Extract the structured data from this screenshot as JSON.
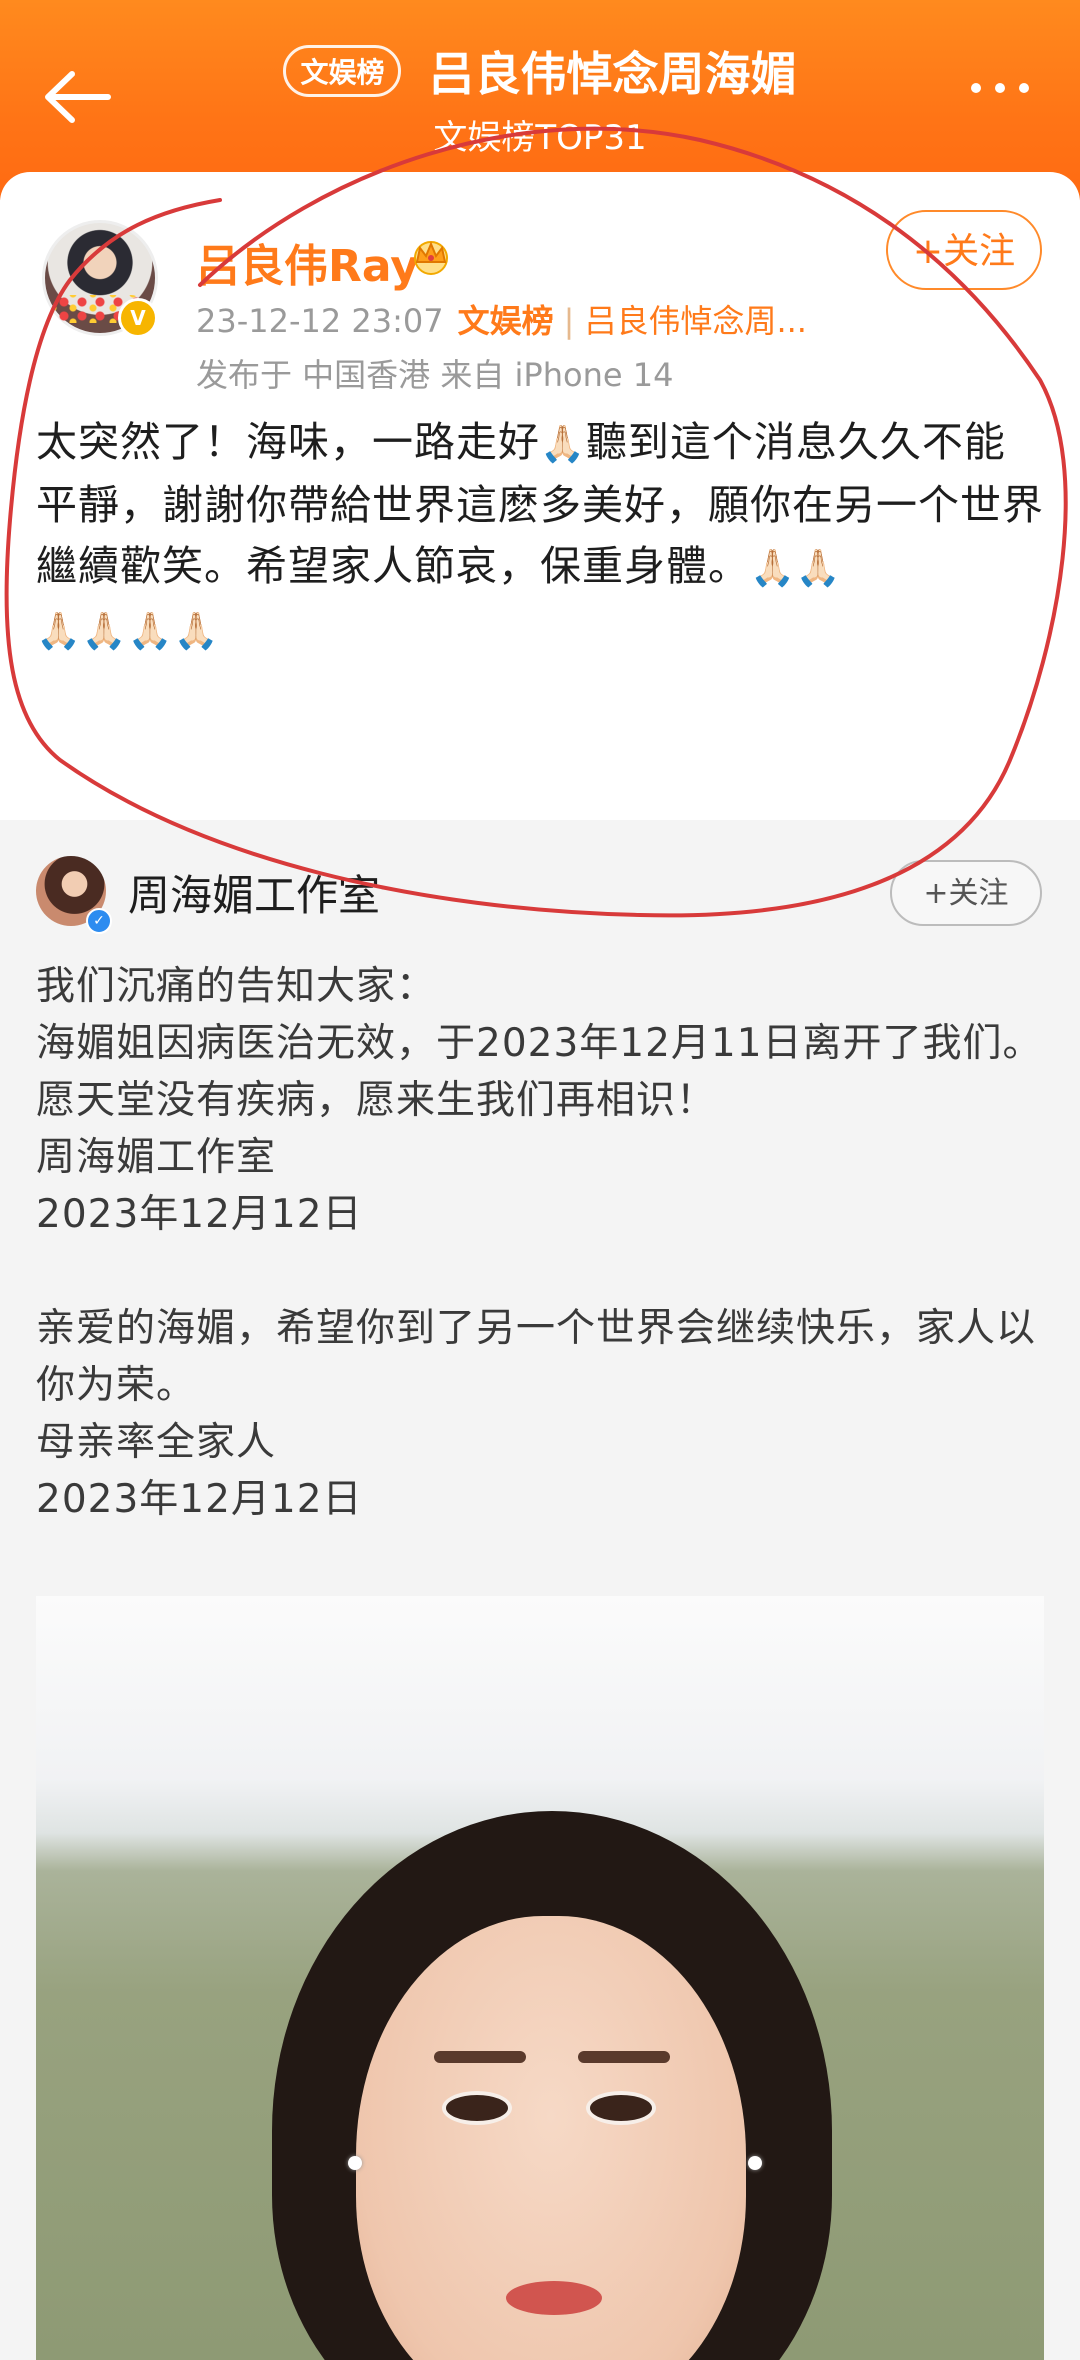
{
  "header": {
    "badge": "文娱榜",
    "title": "吕良伟悼念周海媚",
    "subtitle": "文娱榜TOP31"
  },
  "post": {
    "author": "吕良伟Ray",
    "datetime": "23-12-12 23:07",
    "tag": "文娱榜",
    "topic": "吕良伟悼念周...",
    "source": "发布于 中国香港  来自 iPhone 14",
    "follow_label": "+关注",
    "body_1": "太突然了！海味，一路走好",
    "body_2": "聽到這个消息久久不能平靜，謝謝你帶給世界這麽多美好，願你在另一个世界繼續歡笑。希望家人節哀，保重身體。",
    "pray_emoji_1": "🙏🏻",
    "pray_emoji_2": "🙏🏻🙏🏻",
    "pray_emoji_3": "🙏🏻🙏🏻🙏🏻🙏🏻"
  },
  "repost": {
    "author": "周海媚工作室",
    "follow_label": "+关注",
    "lines": [
      "我们沉痛的告知大家：",
      "海媚姐因病医治无效，于2023年12月11日离开了我们。",
      "愿天堂没有疾病，愿来生我们再相识！",
      "周海媚工作室",
      "2023年12月12日",
      "亲爱的海媚，希望你到了另一个世界会继续快乐，家人以你为荣。",
      "母亲率全家人",
      "2023年12月12日"
    ]
  },
  "colors": {
    "header_orange": "#ff7416",
    "accent_orange": "#ff7a1a",
    "annotation_red": "#d83a3a"
  },
  "icons": [
    "back-arrow-icon",
    "more-icon",
    "crown-icon",
    "verified-gold-icon",
    "verified-blue-icon",
    "pray-emoji-icon"
  ]
}
